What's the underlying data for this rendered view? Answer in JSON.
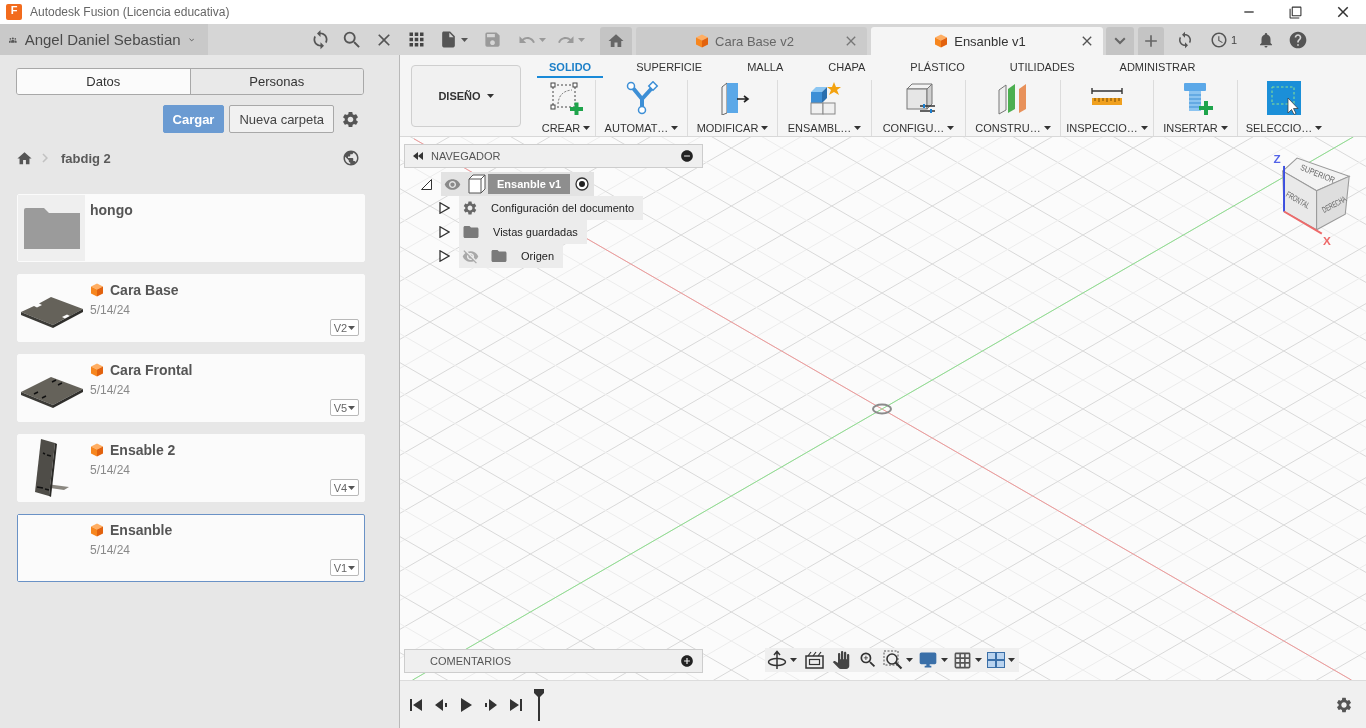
{
  "window": {
    "logo": "F",
    "title": "Autodesk Fusion (Licencia educativa)"
  },
  "top_bar": {
    "user": "Angel Daniel Sebastian",
    "document_tabs": [
      {
        "label": "Cara Base v2",
        "selected": false
      },
      {
        "label": "Ensanble v1",
        "selected": true
      }
    ],
    "jobs_count": "1"
  },
  "data_panel": {
    "tabs": [
      {
        "label": "Datos",
        "selected": true
      },
      {
        "label": "Personas",
        "selected": false
      }
    ],
    "buttons": [
      {
        "label": "Cargar",
        "kind": "primary"
      },
      {
        "label": "Nueva carpeta",
        "kind": "secondary"
      }
    ],
    "breadcrumb": "fabdig 2",
    "items": [
      {
        "kind": "folder",
        "name": "hongo",
        "selected": false
      },
      {
        "kind": "design",
        "name": "Cara Base",
        "date": "5/14/24",
        "version": "V2",
        "selected": false
      },
      {
        "kind": "design",
        "name": "Cara Frontal",
        "date": "5/14/24",
        "version": "V5",
        "selected": false
      },
      {
        "kind": "design",
        "name": "Ensable 2",
        "date": "5/14/24",
        "version": "V4",
        "selected": false
      },
      {
        "kind": "design",
        "name": "Ensanble",
        "date": "5/14/24",
        "version": "V1",
        "selected": true
      }
    ]
  },
  "toolbar": {
    "workspace": "DISEÑO",
    "tabs": [
      {
        "label": "SOLIDO",
        "selected": true
      },
      {
        "label": "SUPERFICIE",
        "selected": false
      },
      {
        "label": "MALLA",
        "selected": false
      },
      {
        "label": "CHAPA",
        "selected": false
      },
      {
        "label": "PLÁSTICO",
        "selected": false
      },
      {
        "label": "UTILIDADES",
        "selected": false
      },
      {
        "label": "ADMINISTRAR",
        "selected": false
      }
    ],
    "tools": [
      "CREAR",
      "AUTOMAT…",
      "MODIFICAR",
      "ENSAMBL…",
      "CONFIGU…",
      "CONSTRU…",
      "INSPECCIO…",
      "INSERTAR",
      "SELECCIO…"
    ]
  },
  "navigator": {
    "title": "NAVEGADOR",
    "root": {
      "label": "Ensanble v1",
      "visible": true,
      "active": true,
      "expanded": true,
      "children": [
        {
          "kind": "settings",
          "label": "Configuración del documento",
          "expanded": false
        },
        {
          "kind": "folder",
          "label": "Vistas guardadas",
          "expanded": false
        },
        {
          "kind": "folder",
          "label": "Origen",
          "visible": false,
          "expanded": false
        }
      ]
    }
  },
  "view_cube": {
    "faces": [
      "SUPERIOR",
      "FRONTAL",
      "DERECHA"
    ],
    "axes": [
      "Z",
      "X"
    ]
  },
  "comments": {
    "title": "COMENTARIOS"
  }
}
